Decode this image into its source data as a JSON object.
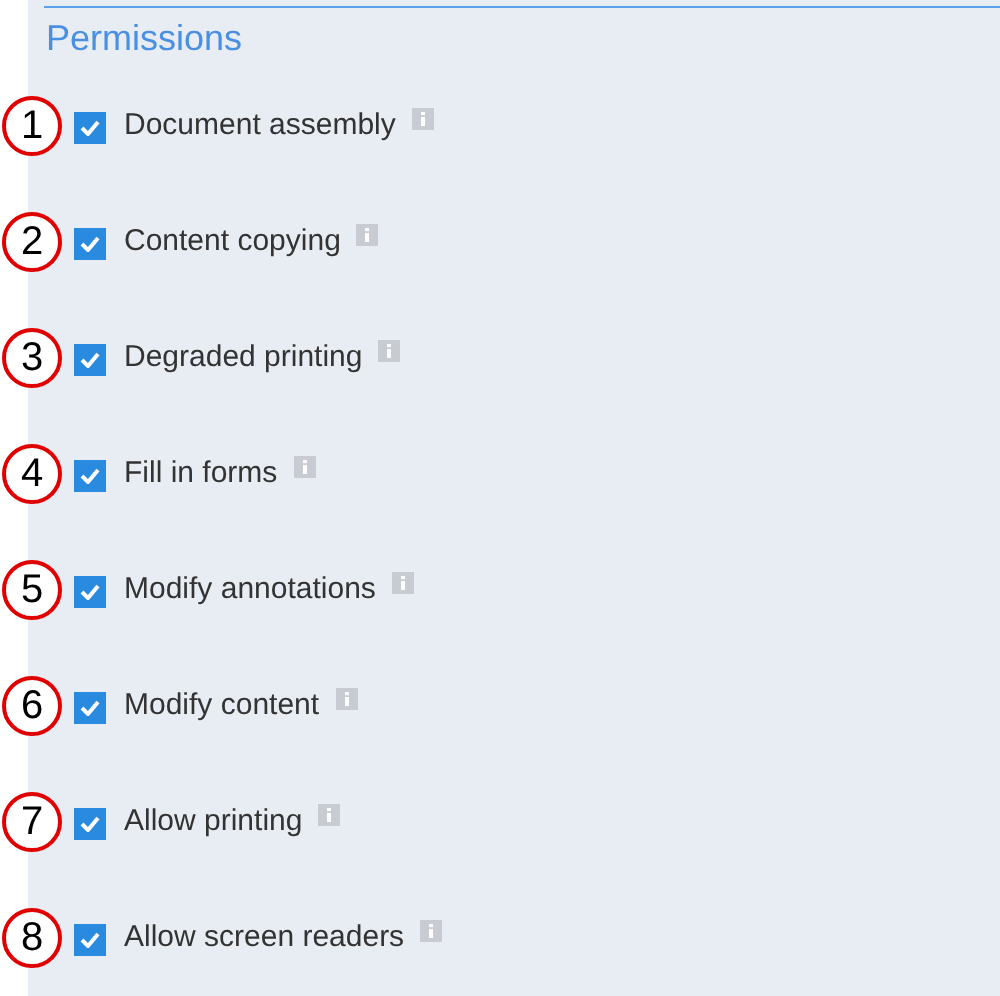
{
  "title": "Permissions",
  "permissions": [
    {
      "number": "1",
      "label": "Document assembly",
      "checked": true
    },
    {
      "number": "2",
      "label": "Content copying",
      "checked": true
    },
    {
      "number": "3",
      "label": "Degraded printing",
      "checked": true
    },
    {
      "number": "4",
      "label": "Fill in forms",
      "checked": true
    },
    {
      "number": "5",
      "label": "Modify annotations",
      "checked": true
    },
    {
      "number": "6",
      "label": "Modify content",
      "checked": true
    },
    {
      "number": "7",
      "label": "Allow printing",
      "checked": true
    },
    {
      "number": "8",
      "label": "Allow screen readers",
      "checked": true
    }
  ]
}
